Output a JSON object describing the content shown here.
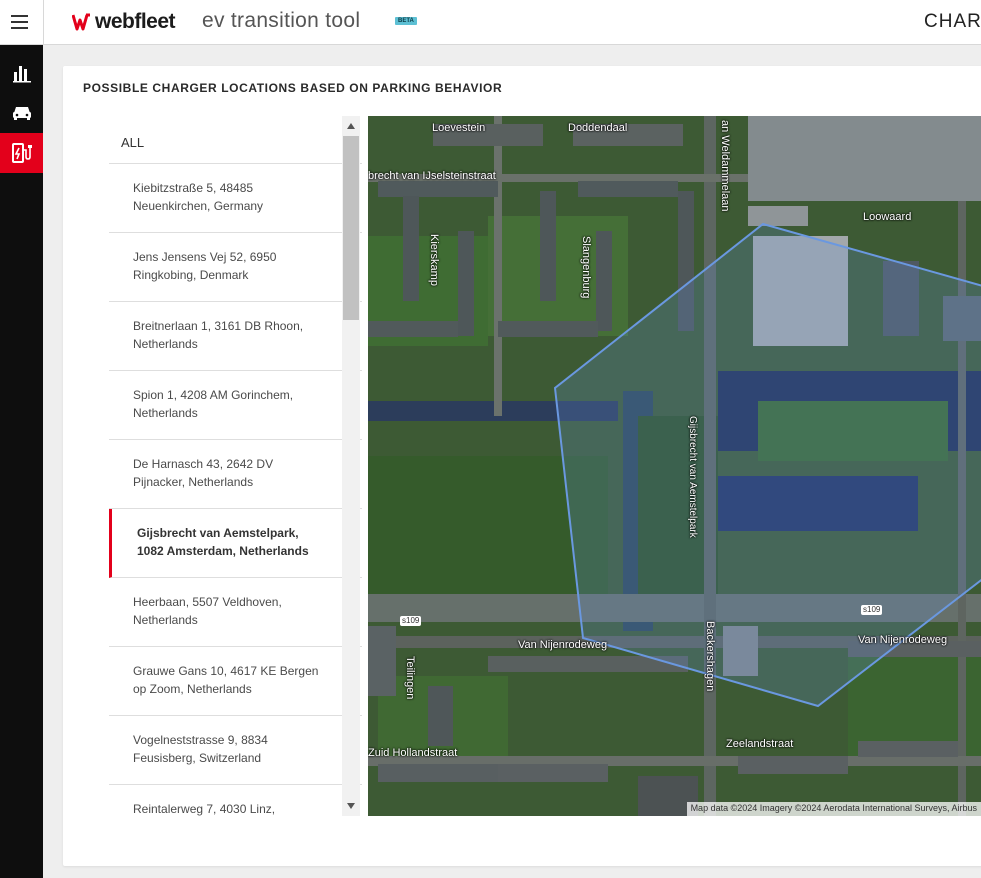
{
  "header": {
    "brand": "webfleet",
    "app_title": "ev transition tool",
    "beta_badge": "BETA",
    "right_label": "CHAR"
  },
  "nav": {
    "items": [
      {
        "icon": "bar-chart-icon",
        "active": false
      },
      {
        "icon": "car-icon",
        "active": false
      },
      {
        "icon": "ev-charger-icon",
        "active": true
      }
    ],
    "active_color": "#e3001b"
  },
  "card": {
    "title": "POSSIBLE CHARGER LOCATIONS BASED ON PARKING BEHAVIOR"
  },
  "locations": {
    "all_label": "ALL",
    "items": [
      {
        "line1": "Kiebitzstraße 5, 48485",
        "line2": "Neuenkirchen, Germany"
      },
      {
        "line1": "Jens Jensens Vej 52, 6950",
        "line2": "Ringkobing, Denmark"
      },
      {
        "line1": "Breitnerlaan 1, 3161 DB Rhoon,",
        "line2": "Netherlands"
      },
      {
        "line1": "Spion 1, 4208 AM Gorinchem,",
        "line2": "Netherlands"
      },
      {
        "line1": "De Harnasch 43, 2642 DV",
        "line2": "Pijnacker, Netherlands"
      },
      {
        "line1": "Gijsbrecht van Aemstelpark,",
        "line2": "1082 Amsterdam, Netherlands",
        "selected": true
      },
      {
        "line1": "Heerbaan, 5507 Veldhoven,",
        "line2": "Netherlands"
      },
      {
        "line1": "Grauwe Gans 10, 4617 KE Bergen",
        "line2": "op Zoom, Netherlands"
      },
      {
        "line1": "Vogelneststrasse 9, 8834",
        "line2": "Feusisberg, Switzerland"
      },
      {
        "line1": "Reintalerweg 7, 4030 Linz,",
        "line2": ""
      }
    ]
  },
  "map": {
    "labels": {
      "loevestein": "Loevestein",
      "doddendaal": "Doddendaal",
      "weldammelaan": "an Weldammelaan",
      "ijselstein": "brecht van IJselsteinstraat",
      "loowaard": "Loowaard",
      "kierskamp": "Kierskamp",
      "slangenburg": "Slangenburg",
      "aemstelpark": "Gijsbrecht van Aemstelpark",
      "nijenrode_left": "Van Nijenrodeweg",
      "nijenrode_right": "Van Nijenrodeweg",
      "teilingen": "Teilingen",
      "backershagen": "Backershagen",
      "zuid_holland": "Zuid Hollandstraat",
      "zeeland": "Zeelandstraat",
      "s109_left": "s109",
      "s109_right": "s109"
    },
    "attribution": "Map data ©2024 Imagery ©2024 Aerodata International Surveys, Airbus",
    "polygon_color": "#6a98e0"
  }
}
